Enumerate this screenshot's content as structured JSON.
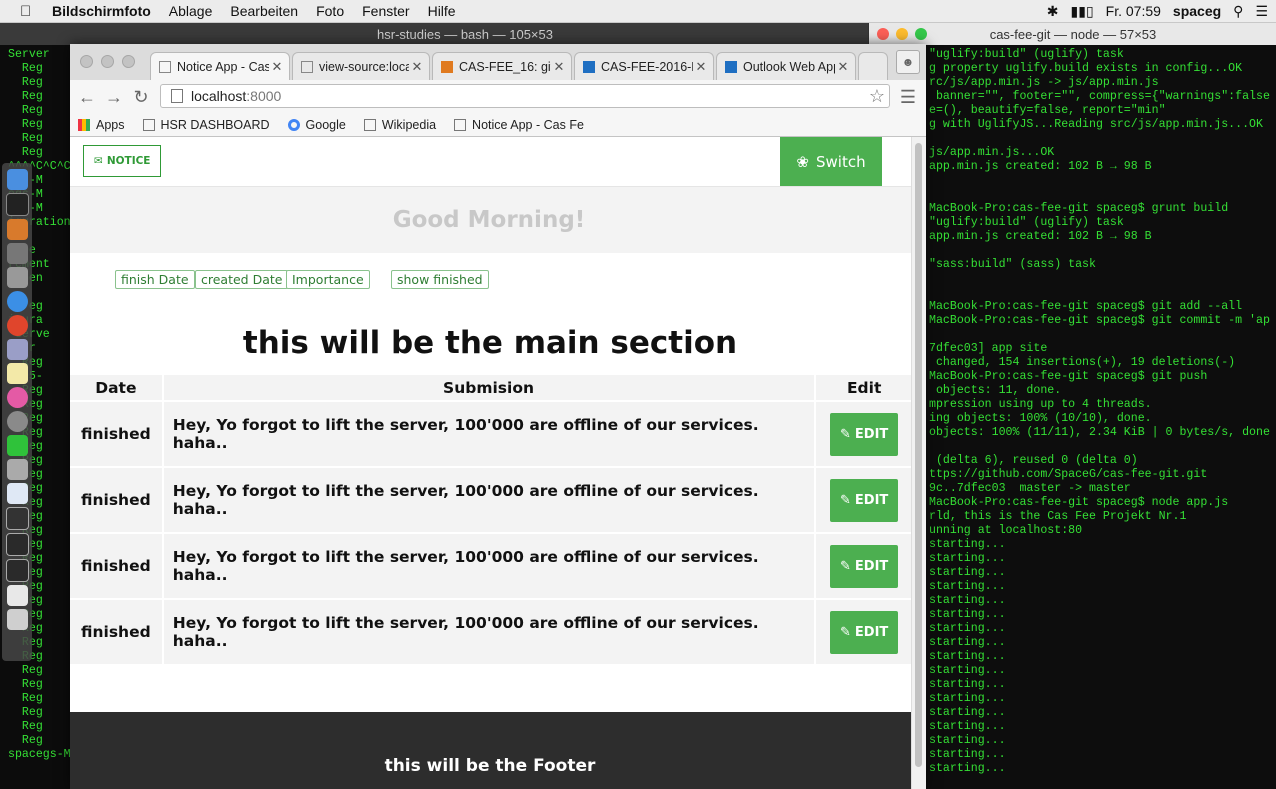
{
  "menubar": {
    "app_name": "Bildschirmfoto",
    "items": [
      "Ablage",
      "Bearbeiten",
      "Foto",
      "Fenster",
      "Hilfe"
    ],
    "clock": "Fr. 07:59",
    "user": "spaceg"
  },
  "terminal_left": {
    "title": "hsr-studies — bash — 105×53",
    "lines": "Server\n  Reg\n  Reg\n  Reg\n  Reg\n  Reg\n  Reg\n  Reg\n^^^^C^C^C\negs-M\negs-M\negs-M\niguration\n\n  De\nrement\n  Gen\n\no-reg\nigura\n Serve\nrver\n  Reg\n6-05-\n  Reg\n  Reg\n  Reg\n  Reg\n  Reg\n  Reg\n  Reg\n  Reg\n  Reg\n  Reg\n  Reg\n  Reg\n  Reg\n  Reg\n  Reg\n  Reg\n  Reg\n  Reg\n  Reg\n  Reg\n  Reg\n  Reg\n  Reg\n  Reg\n  Reg\n  Reg\nspacegs-M"
  },
  "terminal_right": {
    "title": "cas-fee-git — node — 57×53",
    "lines": "\"uglify:build\" (uglify) task\ng property uglify.build exists in config...OK\nrc/js/app.min.js -> js/app.min.js\n banner=\"\", footer=\"\", compress={\"warnings\":false\ne=(), beautify=false, report=\"min\"\ng with UglifyJS...Reading src/js/app.min.js...OK\n\njs/app.min.js...OK\napp.min.js created: 102 B → 98 B\n\n\nMacBook-Pro:cas-fee-git spaceg$ grunt build\n\"uglify:build\" (uglify) task\napp.min.js created: 102 B → 98 B\n\n\"sass:build\" (sass) task\n\n\nMacBook-Pro:cas-fee-git spaceg$ git add --all\nMacBook-Pro:cas-fee-git spaceg$ git commit -m 'ap\n\n7dfec03] app site\n changed, 154 insertions(+), 19 deletions(-)\nMacBook-Pro:cas-fee-git spaceg$ git push\n objects: 11, done.\nmpression using up to 4 threads.\ning objects: 100% (10/10), done.\nobjects: 100% (11/11), 2.34 KiB | 0 bytes/s, done\n\n (delta 6), reused 0 (delta 0)\nttps://github.com/SpaceG/cas-fee-git.git\n9c..7dfec03  master -> master\nMacBook-Pro:cas-fee-git spaceg$ node app.js\nrld, this is the Cas Fee Projekt Nr.1\nunning at localhost:80\nstarting...\nstarting...\nstarting...\nstarting...\nstarting...\nstarting...\nstarting...\nstarting...\nstarting...\nstarting...\nstarting...\nstarting...\nstarting...\nstarting...\nstarting...\nstarting...\nstarting..."
  },
  "browser": {
    "tabs": [
      {
        "label": "Notice App - Cas",
        "active": true
      },
      {
        "label": "view-source:loca",
        "active": false
      },
      {
        "label": "CAS-FEE_16: git",
        "active": false
      },
      {
        "label": "CAS-FEE-2016-H",
        "active": false
      },
      {
        "label": "Outlook Web App",
        "active": false
      }
    ],
    "url_host": "localhost",
    "url_port": ":8000",
    "bookmarks": [
      "Apps",
      "HSR DASHBOARD",
      "Google",
      "Wikipedia",
      "Notice App - Cas Fe"
    ]
  },
  "app": {
    "notice_label": "NOTICE",
    "switch_label": "Switch",
    "greeting": "Good Morning!",
    "filters": [
      "finish Date",
      "created Date",
      "Importance"
    ],
    "show_finished_label": "show finished",
    "main_title": "this will be the main section",
    "table": {
      "headers": [
        "Date",
        "Submision",
        "Edit"
      ],
      "rows": [
        {
          "date": "finished",
          "text": "Hey, Yo forgot to lift the server, 100'000 are offline of our services. haha..",
          "edit": "EDIT"
        },
        {
          "date": "finished",
          "text": "Hey, Yo forgot to lift the server, 100'000 are offline of our services. haha..",
          "edit": "EDIT"
        },
        {
          "date": "finished",
          "text": "Hey, Yo forgot to lift the server, 100'000 are offline of our services. haha..",
          "edit": "EDIT"
        },
        {
          "date": "finished",
          "text": "Hey, Yo forgot to lift the server, 100'000 are offline of our services. haha..",
          "edit": "EDIT"
        }
      ]
    },
    "footer_text": "this will be the Footer"
  },
  "colors": {
    "accent_green": "#4caf50",
    "terminal_green": "#35e035",
    "footer_bg": "#2d2d2d"
  }
}
